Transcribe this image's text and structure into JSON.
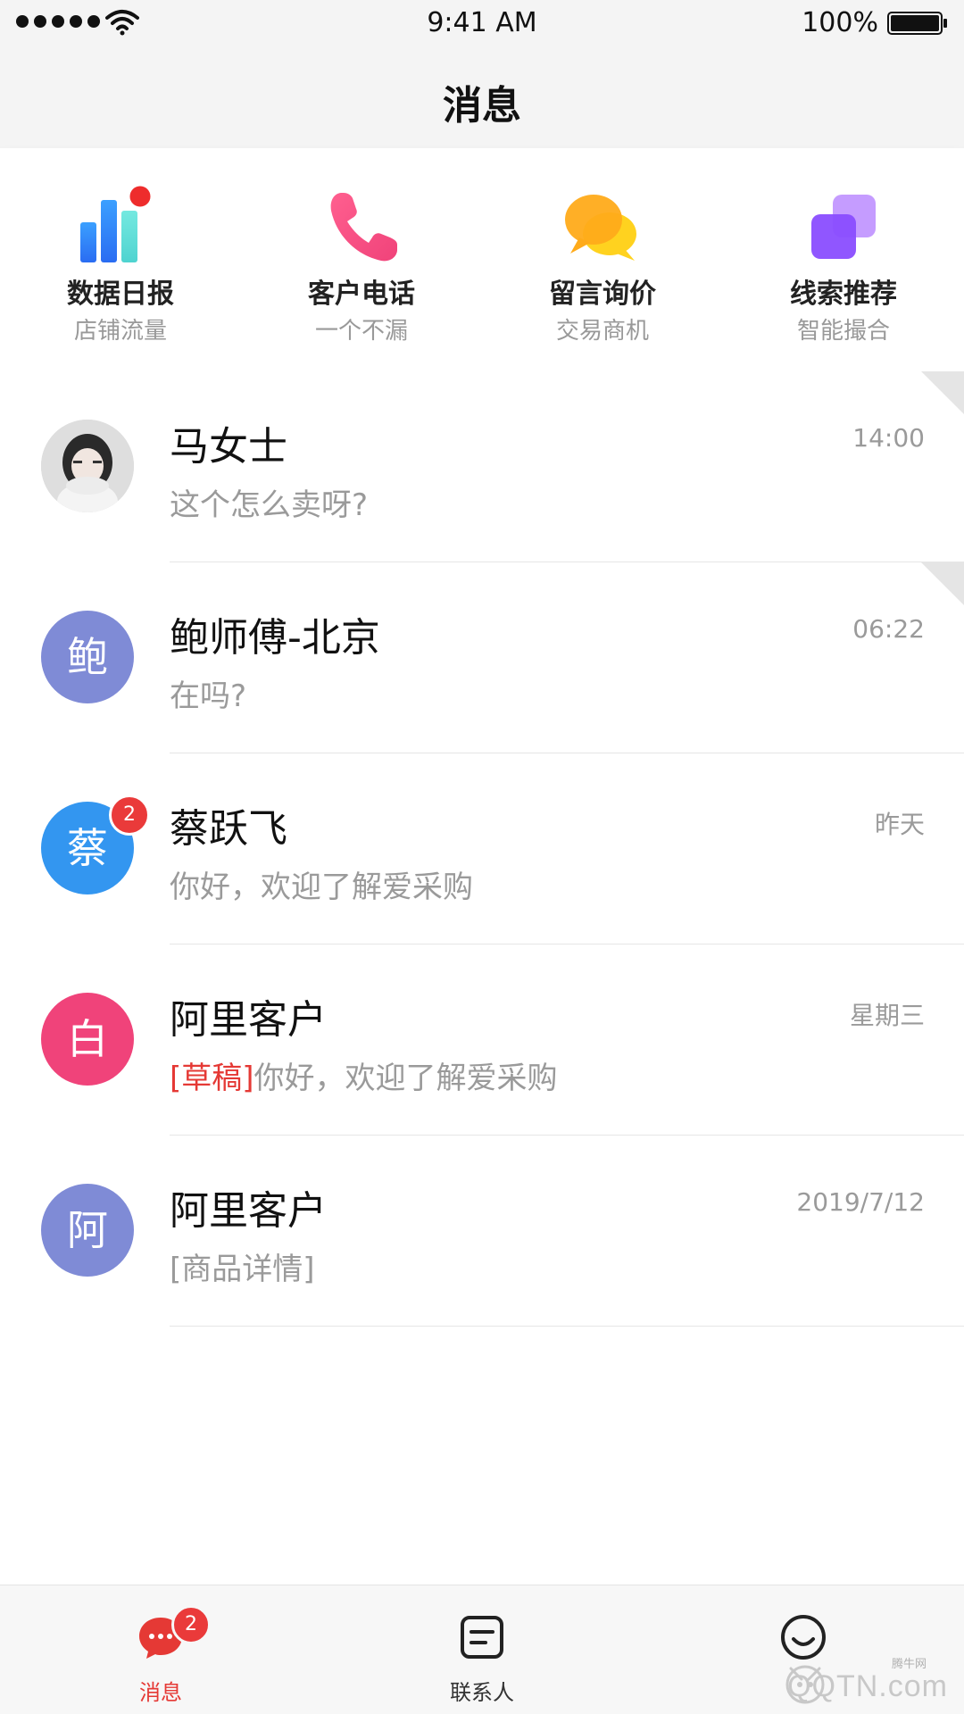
{
  "status_bar": {
    "time": "9:41 AM",
    "battery": "100%"
  },
  "nav": {
    "title": "消息"
  },
  "quick_actions": [
    {
      "title": "数据日报",
      "subtitle": "店铺流量",
      "icon": "bar-chart-icon"
    },
    {
      "title": "客户电话",
      "subtitle": "一个不漏",
      "icon": "phone-icon"
    },
    {
      "title": "留言询价",
      "subtitle": "交易商机",
      "icon": "chat-bubbles-icon"
    },
    {
      "title": "线索推荐",
      "subtitle": "智能撮合",
      "icon": "layers-icon"
    }
  ],
  "conversations": [
    {
      "name": "马女士",
      "time": "14:00",
      "preview": "这个怎么卖呀?",
      "avatar": "photo",
      "pinned": true
    },
    {
      "name": "鲍师傅-北京",
      "time": "06:22",
      "preview": "在吗?",
      "avatar_char": "鲍",
      "avatar_color": "#7f8bd6",
      "pinned": true
    },
    {
      "name": "蔡跃飞",
      "time": "昨天",
      "preview": "你好，欢迎了解爱采购",
      "avatar_char": "蔡",
      "avatar_color": "#3396f0",
      "badge": "2"
    },
    {
      "name": "阿里客户",
      "time": "星期三",
      "draft": "[草稿]",
      "preview": "你好，欢迎了解爱采购",
      "avatar_char": "白",
      "avatar_color": "#f0437a"
    },
    {
      "name": "阿里客户",
      "time": "2019/7/12",
      "preview": "[商品详情]",
      "avatar_char": "阿",
      "avatar_color": "#7f8bd6"
    }
  ],
  "tabs": [
    {
      "label": "消息",
      "icon": "message-icon",
      "active": true,
      "badge": "2"
    },
    {
      "label": "联系人",
      "icon": "contacts-icon",
      "active": false
    },
    {
      "label": "",
      "icon": "smiley-icon",
      "active": false
    }
  ],
  "watermark": {
    "text": "QQTN.com",
    "small": "腾牛网"
  },
  "colors": {
    "accent": "#e53935",
    "badge": "#ea3a3a"
  }
}
